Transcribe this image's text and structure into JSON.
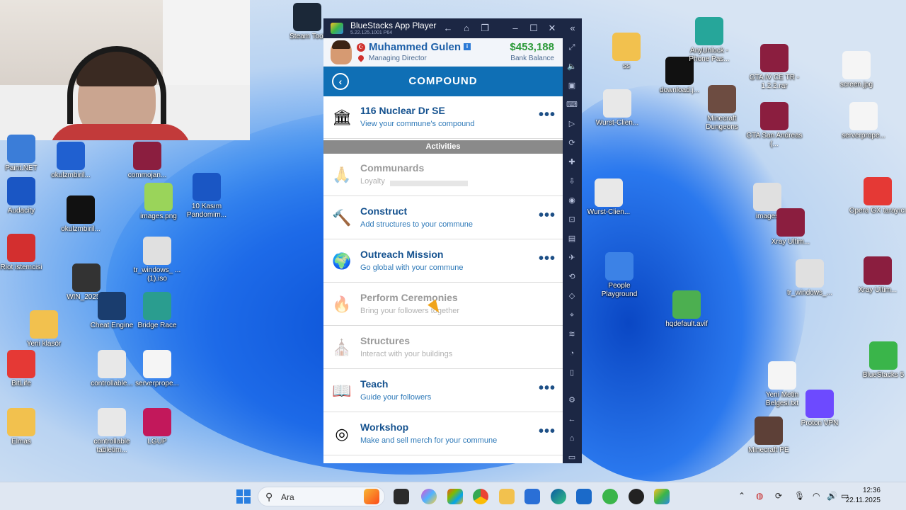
{
  "desktop": {
    "icons": [
      {
        "label": "Steam Tool",
        "color": "#1b2838"
      },
      {
        "label": "Paint.NET",
        "color": "#3b7dd8"
      },
      {
        "label": "okulzmbiril...",
        "color": "#2060d0"
      },
      {
        "label": "commojan...",
        "color": "#8b1e3f"
      },
      {
        "label": "Audacity",
        "color": "#1a56c4"
      },
      {
        "label": "okulzmbiril...",
        "color": "#111111"
      },
      {
        "label": "images.png",
        "color": "#9ad45a"
      },
      {
        "label": "10 Kasım Pandomim...",
        "color": "#1a56c4"
      },
      {
        "label": "Riot istemcisi",
        "color": "#d32f2f"
      },
      {
        "label": "WIN_2025...",
        "color": "#333333"
      },
      {
        "label": "tr_windows_ ...(1).iso",
        "color": "#e0e0e0"
      },
      {
        "label": "Yeni klasör",
        "color": "#f2c14e"
      },
      {
        "label": "Cheat Engine",
        "color": "#1a3d6e"
      },
      {
        "label": "Bridge Race",
        "color": "#2a9d8f"
      },
      {
        "label": "BitLife",
        "color": "#e53935"
      },
      {
        "label": "controllable...",
        "color": "#e8e8e8"
      },
      {
        "label": "serverprope...",
        "color": "#f5f5f5"
      },
      {
        "label": "Elmas",
        "color": "#f2c14e"
      },
      {
        "label": "controllable tabletim...",
        "color": "#e8e8e8"
      },
      {
        "label": "LGUP",
        "color": "#c2185b"
      },
      {
        "label": "ss",
        "color": "#f2c14e"
      },
      {
        "label": "download.j...",
        "color": "#111111"
      },
      {
        "label": "AnyUnlock - Phone Pas...",
        "color": "#26a69a"
      },
      {
        "label": "GTA IV CE TR - 1.2.2.rar",
        "color": "#8b1e3f"
      },
      {
        "label": "screen.jpg",
        "color": "#f5f5f5"
      },
      {
        "label": "Wurst-Clien...",
        "color": "#e8e8e8"
      },
      {
        "label": "Minecraft Dungeons",
        "color": "#6d4c41"
      },
      {
        "label": "GTA San Andreas (...",
        "color": "#8b1e3f"
      },
      {
        "label": "serverprope...",
        "color": "#f5f5f5"
      },
      {
        "label": "Wurst-Clien...",
        "color": "#e8e8e8"
      },
      {
        "label": "images",
        "color": "#e0e0e0"
      },
      {
        "label": "Opera GX tarayıcı",
        "color": "#e53935"
      },
      {
        "label": "Xray Ultim...",
        "color": "#8b1e3f"
      },
      {
        "label": "People Playground",
        "color": "#3c82e6"
      },
      {
        "label": "hqdefault.avif",
        "color": "#4caf50"
      },
      {
        "label": "tr_windows_...",
        "color": "#e0e0e0"
      },
      {
        "label": "Xray Ultim...",
        "color": "#8b1e3f"
      },
      {
        "label": "BlueStacks 5",
        "color": "#3ab54a"
      },
      {
        "label": "Yeni Metin Belgesi.txt",
        "color": "#f5f5f5"
      },
      {
        "label": "Proton VPN",
        "color": "#6d4aff"
      },
      {
        "label": "Minecraft PE",
        "color": "#5d4037"
      }
    ]
  },
  "window": {
    "title": "BlueStacks App Player",
    "version": "5.22.125.1001 P64"
  },
  "header": {
    "name": "Muhammed Gulen",
    "role": "Managing Director",
    "balance": "$453,188",
    "balance_label": "Bank Balance"
  },
  "screen": {
    "title": "COMPOUND"
  },
  "compound_row": {
    "title": "116 Nuclear Dr SE",
    "subtitle": "View your commune's compound"
  },
  "section": {
    "label": "Activities"
  },
  "activities": [
    {
      "title": "Communards",
      "subtitle": "Loyalty",
      "icon": "praying-hands-icon",
      "glyph": "🙏",
      "enabled": false
    },
    {
      "title": "Construct",
      "subtitle": "Add structures to your commune",
      "icon": "hammer-icon",
      "glyph": "🔨",
      "enabled": true
    },
    {
      "title": "Outreach Mission",
      "subtitle": "Go global with your commune",
      "icon": "globe-icon",
      "glyph": "🌍",
      "enabled": true
    },
    {
      "title": "Perform Ceremonies",
      "subtitle": "Bring your followers together",
      "icon": "flame-icon",
      "glyph": "🔥",
      "enabled": false
    },
    {
      "title": "Structures",
      "subtitle": "Interact with your buildings",
      "icon": "church-icon",
      "glyph": "⛪",
      "enabled": false
    },
    {
      "title": "Teach",
      "subtitle": "Guide your followers",
      "icon": "book-icon",
      "glyph": "📖",
      "enabled": true
    },
    {
      "title": "Workshop",
      "subtitle": "Make and sell merch for your commune",
      "icon": "target-icon",
      "glyph": "◎",
      "enabled": true
    }
  ],
  "taskbar": {
    "search_placeholder": "Ara",
    "time": "12:36",
    "date": "22.11.2025"
  }
}
